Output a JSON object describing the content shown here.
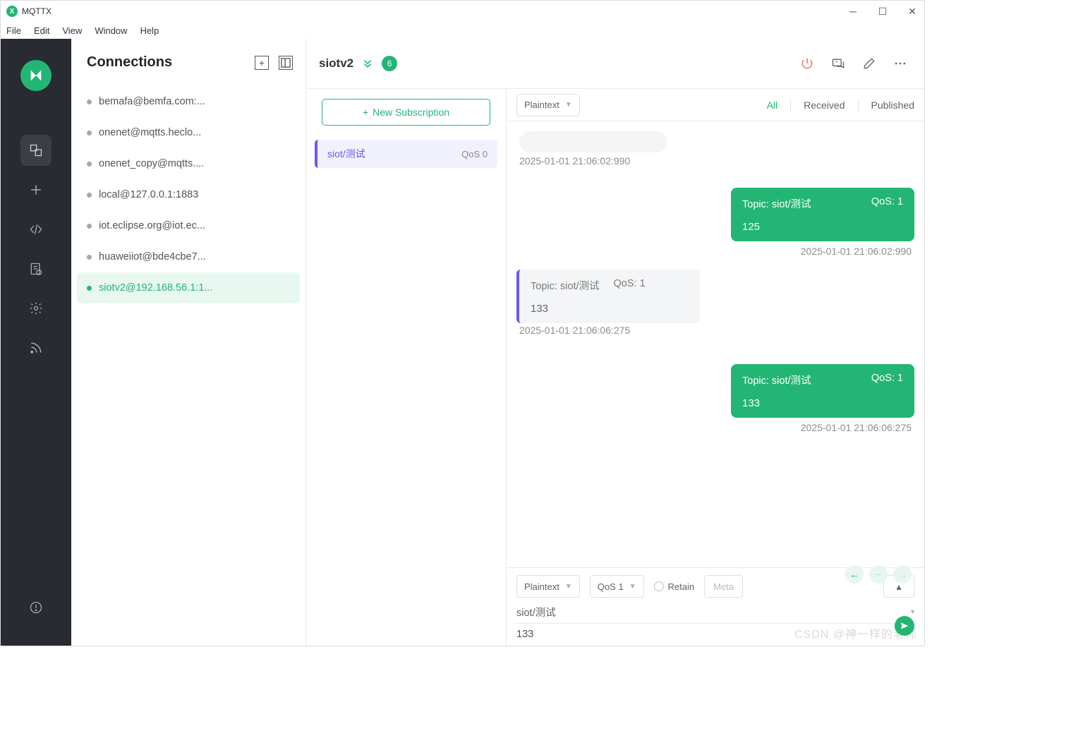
{
  "app": {
    "title": "MQTTX"
  },
  "menu": {
    "file": "File",
    "edit": "Edit",
    "view": "View",
    "window": "Window",
    "help": "Help"
  },
  "sidebar": {
    "title": "Connections"
  },
  "connections": [
    {
      "label": "bemafa@bemfa.com:..."
    },
    {
      "label": "onenet@mqtts.heclo..."
    },
    {
      "label": "onenet_copy@mqtts...."
    },
    {
      "label": "local@127.0.0.1:1883"
    },
    {
      "label": "iot.eclipse.org@iot.ec..."
    },
    {
      "label": "huaweiiot@bde4cbe7..."
    },
    {
      "label": "siotv2@192.168.56.1:1..."
    }
  ],
  "header": {
    "name": "siotv2",
    "badge": "6"
  },
  "subs": {
    "new_label": "New Subscription",
    "items": [
      {
        "topic": "siot/测试",
        "qos": "QoS 0"
      }
    ]
  },
  "msgbar": {
    "format": "Plaintext",
    "filters": {
      "all": "All",
      "received": "Received",
      "published": "Published"
    }
  },
  "messages": {
    "ts0": "2025-01-01 21:06:02:990",
    "out1": {
      "topic": "Topic: siot/测试",
      "qos": "QoS: 1",
      "payload": "125",
      "ts": "2025-01-01 21:06:02:990"
    },
    "in1": {
      "topic": "Topic: siot/测试",
      "qos": "QoS: 1",
      "payload": "133",
      "ts": "2025-01-01 21:06:06:275"
    },
    "out2": {
      "topic": "Topic: siot/测试",
      "qos": "QoS: 1",
      "payload": "133",
      "ts": "2025-01-01 21:06:06:275"
    }
  },
  "publish": {
    "format": "Plaintext",
    "qos": "QoS 1",
    "retain": "Retain",
    "meta": "Meta",
    "topic": "siot/测试",
    "payload": "133"
  },
  "watermark": "CSDN @神一样的老师"
}
